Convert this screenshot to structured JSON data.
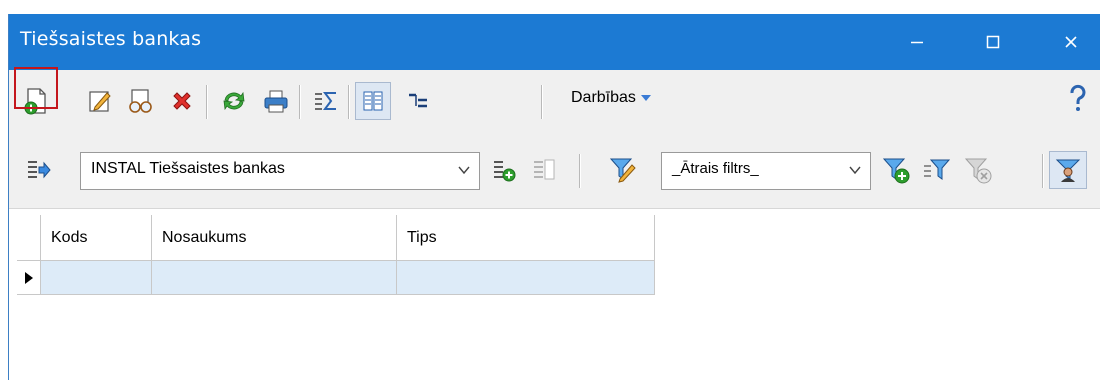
{
  "window": {
    "title": "Tiešsaistes bankas"
  },
  "toolbar": {
    "actions_label": "Darbības",
    "icons": [
      "new-document-icon",
      "edit-pencil-icon",
      "view-glasses-icon",
      "delete-x-icon",
      "refresh-icon",
      "print-icon",
      "sum-icon",
      "columns-icon",
      "tree-icon",
      "help-icon"
    ]
  },
  "view_selector": {
    "value": "INSTAL Tiešsaistes bankas"
  },
  "quick_filter": {
    "value": "_Ātrais filtrs_"
  },
  "table": {
    "columns": [
      "Kods",
      "Nosaukums",
      "Tips"
    ],
    "rows": [
      [
        "",
        "",
        ""
      ]
    ]
  },
  "colors": {
    "titlebar": "#1c7ad3",
    "highlight": "#c4161c",
    "selected_row": "#ddebf8"
  }
}
